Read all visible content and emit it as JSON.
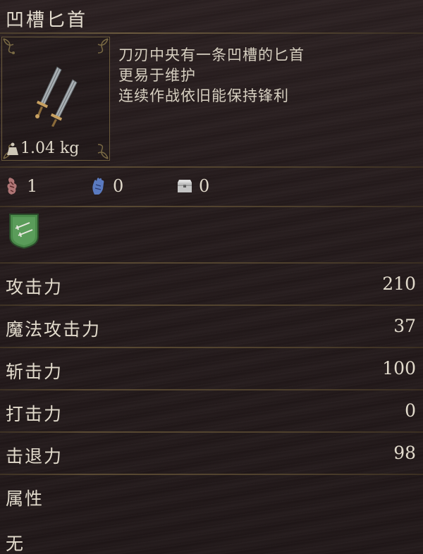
{
  "item": {
    "name": "凹槽匕首",
    "weight": "1.04 kg",
    "description": [
      "刀刃中央有一条凹槽的匕首",
      "更易于维护",
      "连续作战依旧能保持锋利"
    ]
  },
  "requirements": [
    {
      "icon": "strength-icon",
      "value": "1",
      "color": "#b87a7a"
    },
    {
      "icon": "dexterity-hand-icon",
      "value": "0",
      "color": "#6a8ac8"
    },
    {
      "icon": "chest-icon",
      "value": "0",
      "color": "#c8c8c8"
    }
  ],
  "attributes": [
    {
      "label": "攻击力",
      "value": "210"
    },
    {
      "label": "魔法攻击力",
      "value": "37"
    },
    {
      "label": "斩击力",
      "value": "100"
    },
    {
      "label": "打击力",
      "value": "0"
    },
    {
      "label": "击退力",
      "value": "98"
    }
  ],
  "element": {
    "label": "属性",
    "value": "无"
  }
}
